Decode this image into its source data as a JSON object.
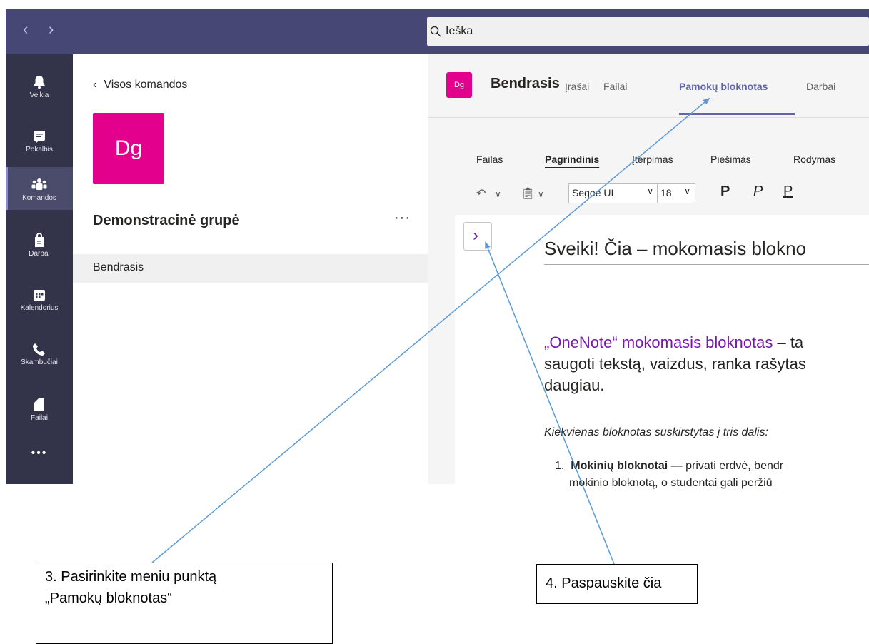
{
  "topbar": {
    "back": "‹",
    "forward": "›",
    "search_placeholder": "Ieška"
  },
  "rail": [
    {
      "label": "Veikla",
      "icon": "bell-icon"
    },
    {
      "label": "Pokalbis",
      "icon": "chat-icon"
    },
    {
      "label": "Komandos",
      "icon": "teams-icon",
      "active": true
    },
    {
      "label": "Darbai",
      "icon": "assignments-icon"
    },
    {
      "label": "Kalendorius",
      "icon": "calendar-icon"
    },
    {
      "label": "Skambučiai",
      "icon": "phone-icon"
    },
    {
      "label": "Failai",
      "icon": "files-icon"
    },
    {
      "label": "•••",
      "icon": "more-icon"
    }
  ],
  "team_panel": {
    "back_label": "Visos komandos",
    "logo_text": "Dg",
    "team_name": "Demonstracinė grupė",
    "more": "···",
    "channel": "Bendrasis"
  },
  "channel": {
    "logo_text": "Dg",
    "title": "Bendrasis",
    "tabs": [
      "Įrašai",
      "Failai",
      "Pamokų bloknotas",
      "Darbai"
    ],
    "active_tab": "Pamokų bloknotas"
  },
  "ribbon": {
    "tabs": [
      "Failas",
      "Pagrindinis",
      "Įterpimas",
      "Piešimas",
      "Rodymas"
    ],
    "active_tab": "Pagrindinis",
    "font": "Segoe UI",
    "size": "18",
    "bold": "P",
    "italic": "P",
    "underline": "P"
  },
  "page": {
    "title": "Sveiki! Čia – mokomasis blokno",
    "para1_link": "„OneNote“ mokomasis bloknotas",
    "para1_rest": " – ta",
    "para1_line2": "saugoti tekstą, vaizdus, ranka rašytas",
    "para1_line3": "daugiau.",
    "para2": "Kiekvienas bloknotas suskirstytas į tris dalis:",
    "list_num": "1.",
    "list_bold": "Mokinių bloknotai",
    "list_rest": " — privati erdvė, bendr",
    "list_line2": "mokinio bloknotą, o studentai gali peržiū"
  },
  "callouts": {
    "step3_line1": "3. Pasirinkite meniu punktą",
    "step3_line2": "„Pamokų bloknotas“",
    "step4": "4. Paspauskite čia"
  }
}
